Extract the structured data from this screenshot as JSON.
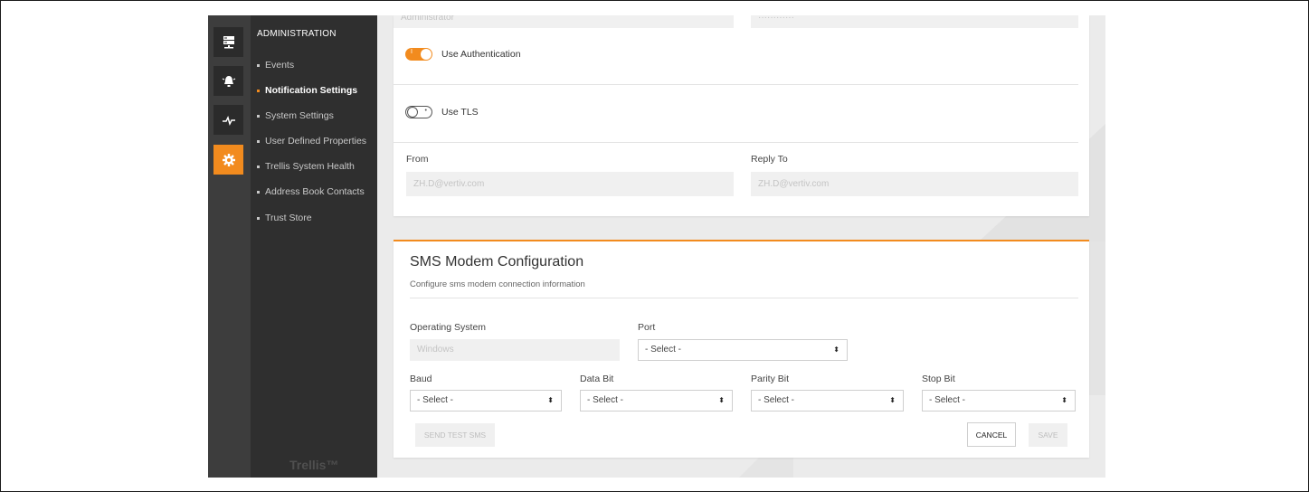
{
  "sidebar": {
    "section_title": "ADMINISTRATION",
    "items": [
      {
        "label": "Events",
        "active": false
      },
      {
        "label": "Notification Settings",
        "active": true
      },
      {
        "label": "System Settings",
        "active": false
      },
      {
        "label": "User Defined Properties",
        "active": false
      },
      {
        "label": "Trellis System Health",
        "active": false
      },
      {
        "label": "Address Book Contacts",
        "active": false
      },
      {
        "label": "Trust Store",
        "active": false
      }
    ],
    "brand": "Trellis™",
    "rail_icons": [
      "server-icon",
      "alarm-bell-icon",
      "pulse-icon",
      "gear-icon"
    ]
  },
  "email": {
    "username_value": "Administrator",
    "password_value": "············",
    "use_auth_label": "Use Authentication",
    "use_auth_on": true,
    "use_tls_label": "Use TLS",
    "use_tls_on": false,
    "from_label": "From",
    "from_value": "ZH.D@vertiv.com",
    "reply_to_label": "Reply To",
    "reply_to_value": "ZH.D@vertiv.com"
  },
  "sms": {
    "title": "SMS Modem Configuration",
    "subtitle": "Configure sms modem connection information",
    "os_label": "Operating System",
    "os_value": "Windows",
    "port_label": "Port",
    "port_value": "- Select -",
    "baud_label": "Baud",
    "baud_value": "- Select -",
    "data_bit_label": "Data Bit",
    "data_bit_value": "- Select -",
    "parity_bit_label": "Parity Bit",
    "parity_bit_value": "- Select -",
    "stop_bit_label": "Stop Bit",
    "stop_bit_value": "- Select -",
    "send_test_label": "SEND TEST SMS",
    "cancel_label": "CANCEL",
    "save_label": "SAVE"
  },
  "colors": {
    "accent": "#f28b1e",
    "nav_bg": "#2f2f2f",
    "rail_bg": "#3d3d3d"
  }
}
